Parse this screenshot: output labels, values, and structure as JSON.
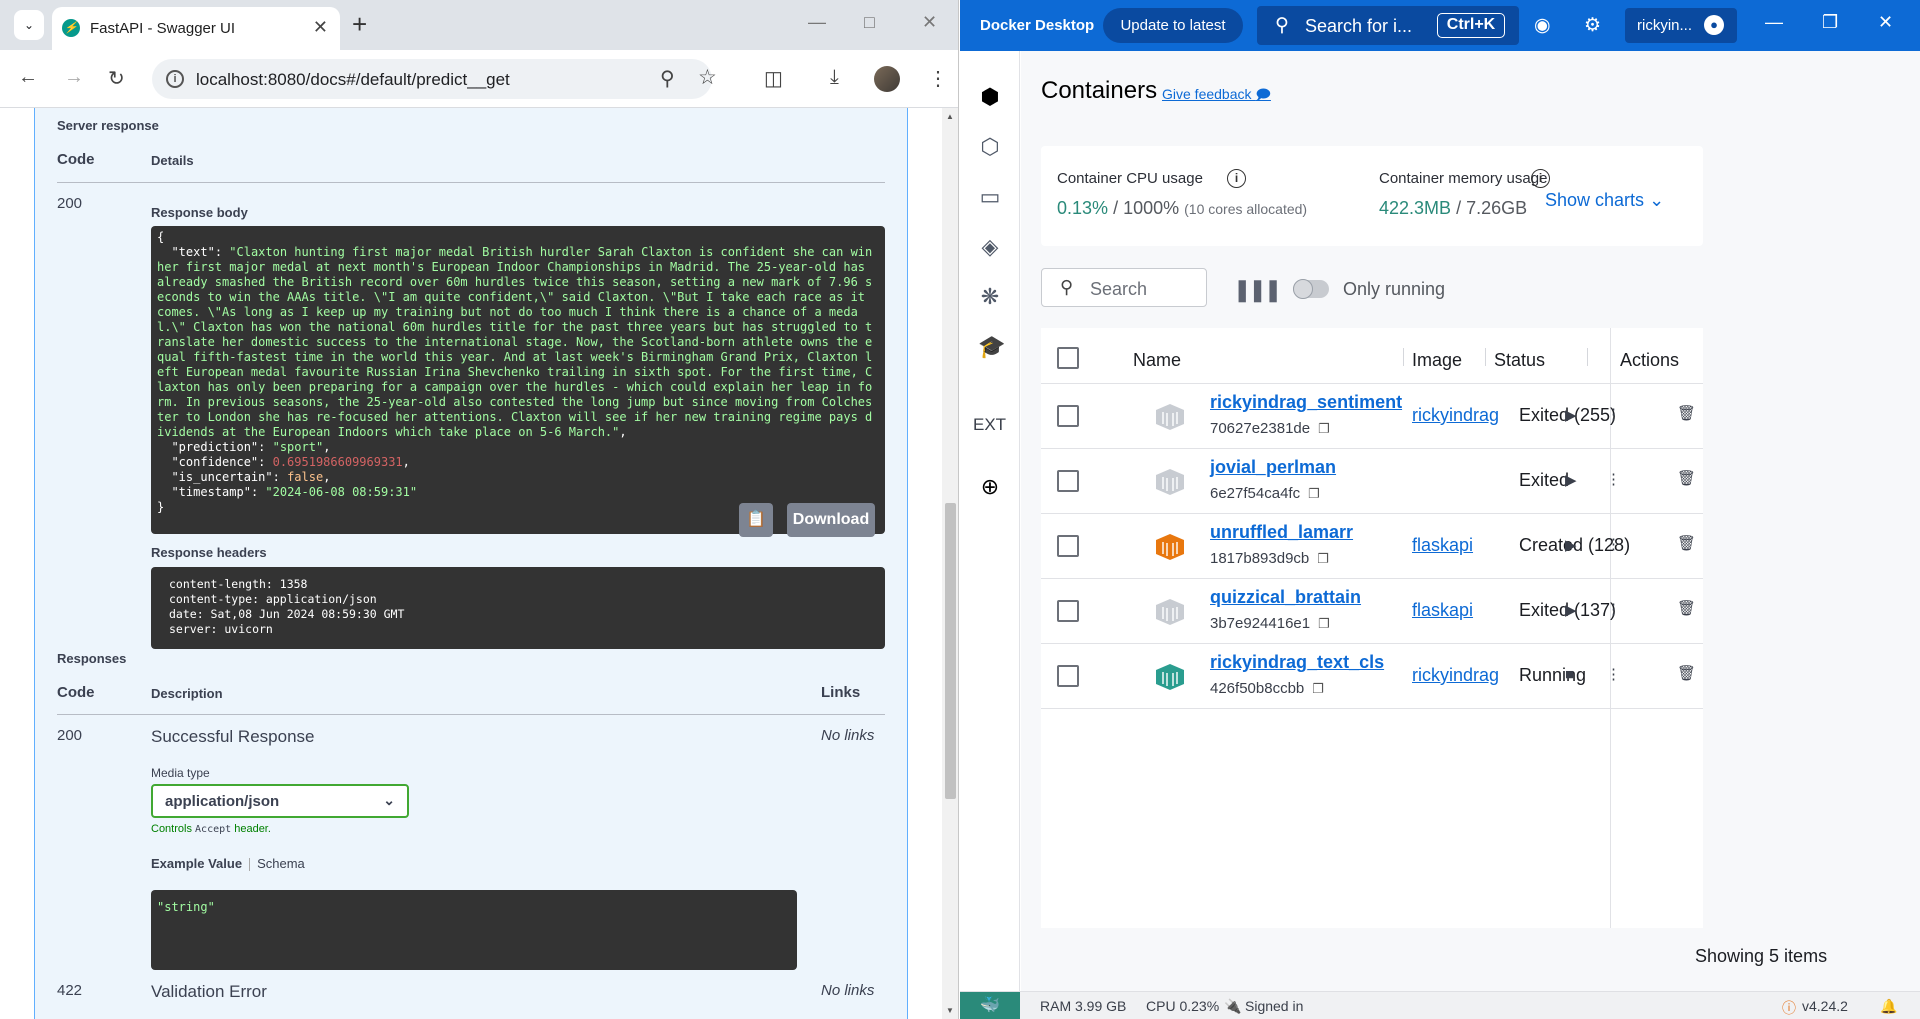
{
  "browser": {
    "tab_title": "FastAPI - Swagger UI",
    "url": "localhost:8080/docs#/default/predict__get"
  },
  "swagger": {
    "server_response_label": "Server response",
    "code_header": "Code",
    "details_header": "Details",
    "response_code": "200",
    "response_body_label": "Response body",
    "response_json": {
      "text_key": "\"text\"",
      "text_value": "\"Claxton hunting first major medal British hurdler Sarah Claxton is confident she can win her first major medal at next month's European Indoor Championships in Madrid. The 25-year-old has already smashed the British record over 60m hurdles twice this season, setting a new mark of 7.96 seconds to win the AAAs title. \\\"I am quite confident,\\\" said Claxton. \\\"But I take each race as it comes. \\\"As long as I keep up my training but not do too much I think there is a chance of a medal.\\\" Claxton has won the national 60m hurdles title for the past three years but has struggled to translate her domestic success to the international stage. Now, the Scotland-born athlete owns the equal fifth-fastest time in the world this year. And at last week's Birmingham Grand Prix, Claxton left European medal favourite Russian Irina Shevchenko trailing in sixth spot. For the first time, Claxton has only been preparing for a campaign over the hurdles - which could explain her leap in form. In previous seasons, the 25-year-old also contested the long jump but since moving from Colchester to London she has re-focused her attentions. Claxton will see if her new training regime pays dividends at the European Indoors which take place on 5-6 March.\"",
      "prediction_key": "\"prediction\"",
      "prediction_value": "\"sport\"",
      "confidence_key": "\"confidence\"",
      "confidence_value": "0.6951986609969331",
      "is_uncertain_key": "\"is_uncertain\"",
      "is_uncertain_value": "false",
      "timestamp_key": "\"timestamp\"",
      "timestamp_value": "\"2024-06-08 08:59:31\""
    },
    "download_label": "Download",
    "response_headers_label": "Response headers",
    "response_headers": [
      "content-length: 1358",
      "content-type: application/json",
      "date: Sat,08 Jun 2024 08:59:30 GMT",
      "server: uvicorn"
    ],
    "responses_label": "Responses",
    "description_header": "Description",
    "links_header": "Links",
    "resp_200_code": "200",
    "resp_200_desc": "Successful Response",
    "resp_200_links": "No links",
    "media_type_label": "Media type",
    "media_type_value": "application/json",
    "controls_prefix": "Controls",
    "controls_code": "Accept",
    "controls_suffix": "header.",
    "example_value_label": "Example Value",
    "schema_label": "Schema",
    "example_value": "\"string\"",
    "resp_422_code": "422",
    "resp_422_desc": "Validation Error",
    "resp_422_links": "No links"
  },
  "docker": {
    "app_name": "Docker Desktop",
    "update_label": "Update to latest",
    "search_label": "Search for i...",
    "search_shortcut": "Ctrl+K",
    "username": "rickyin...",
    "page_title": "Containers",
    "feedback_label": "Give feedback",
    "cpu_label": "Container CPU usage",
    "cpu_value": "0.13%",
    "cpu_total": "/ 1000%",
    "cpu_sub": "(10 cores allocated)",
    "mem_label": "Container memory usage",
    "mem_value": "422.3MB",
    "mem_total": "/ 7.26GB",
    "show_charts": "Show charts",
    "search_placeholder": "Search",
    "only_running": "Only running",
    "columns": {
      "name": "Name",
      "image": "Image",
      "status": "Status",
      "actions": "Actions"
    },
    "containers": [
      {
        "name": "rickyindrag_sentiment",
        "id": "70627e2381de",
        "image": "rickyindrag",
        "status": "Exited (255)",
        "icon_color": "#c8ccd2",
        "running": false
      },
      {
        "name": "jovial_perlman",
        "id": "6e27f54ca4fc",
        "image": "",
        "status": "Exited",
        "icon_color": "#c8ccd2",
        "running": false
      },
      {
        "name": "unruffled_lamarr",
        "id": "1817b893d9cb",
        "image": "flaskapi",
        "status": "Created (128)",
        "icon_color": "#e8770e",
        "running": false
      },
      {
        "name": "quizzical_brattain",
        "id": "3b7e924416e1",
        "image": "flaskapi",
        "status": "Exited (137)",
        "icon_color": "#c8ccd2",
        "running": false
      },
      {
        "name": "rickyindrag_text_cls",
        "id": "426f50b8ccbb",
        "image": "rickyindrag",
        "status": "Running",
        "icon_color": "#2a9d8f",
        "running": true
      }
    ],
    "showing": "Showing 5 items",
    "footer": {
      "ram": "RAM 3.99 GB",
      "cpu": "CPU 0.23%",
      "signed_in": "Signed in",
      "version": "v4.24.2"
    },
    "accent": "#0d6ad5"
  }
}
